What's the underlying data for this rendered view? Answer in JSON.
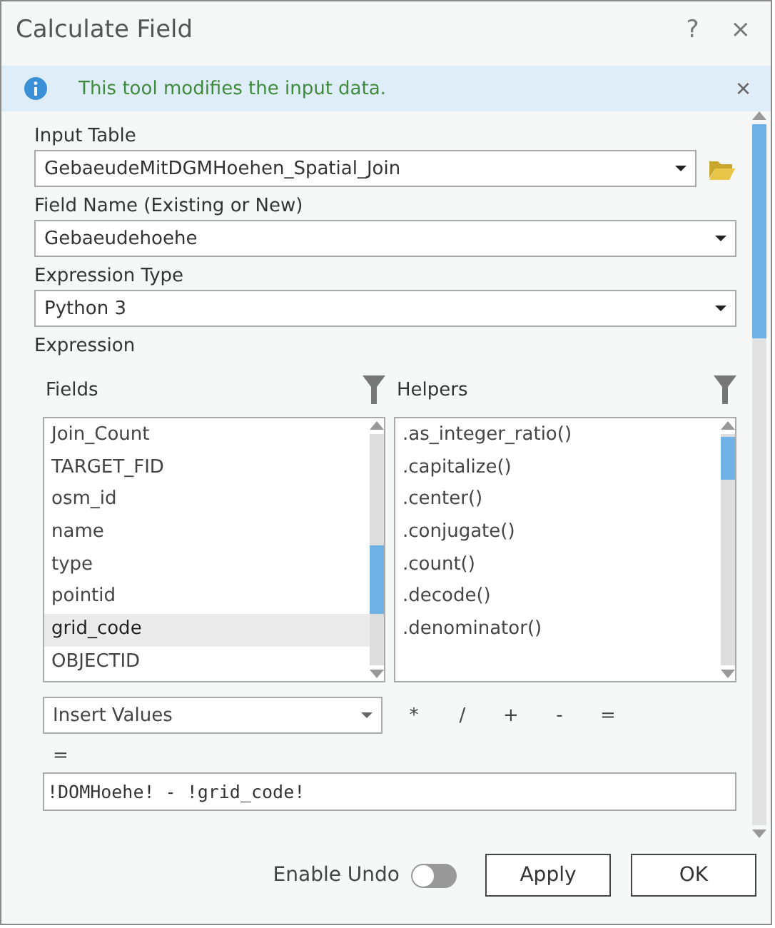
{
  "window": {
    "title": "Calculate Field",
    "help": "?",
    "close": "×"
  },
  "banner": {
    "message": "This tool modifies the input data.",
    "close": "×"
  },
  "input_table": {
    "label": "Input Table",
    "value": "GebaeudeMitDGMHoehen_Spatial_Join"
  },
  "field_name": {
    "label": "Field Name (Existing or New)",
    "value": "Gebaeudehoehe"
  },
  "expression_type": {
    "label": "Expression Type",
    "value": "Python 3"
  },
  "expression": {
    "label": "Expression",
    "fields": {
      "title": "Fields",
      "items": [
        {
          "label": "Join_Count",
          "selected": false
        },
        {
          "label": "TARGET_FID",
          "selected": false
        },
        {
          "label": "osm_id",
          "selected": false
        },
        {
          "label": "name",
          "selected": false
        },
        {
          "label": "type",
          "selected": false
        },
        {
          "label": "pointid",
          "selected": false
        },
        {
          "label": "grid_code",
          "selected": true
        },
        {
          "label": "OBJECTID",
          "selected": false
        }
      ]
    },
    "helpers": {
      "title": "Helpers",
      "items": [
        ".as_integer_ratio()",
        ".capitalize()",
        ".center()",
        ".conjugate()",
        ".count()",
        ".decode()",
        ".denominator()"
      ]
    },
    "insert_values": "Insert Values",
    "operators": [
      "*",
      "/",
      "+",
      "-",
      "="
    ],
    "equals": "=",
    "code": "!DOMHoehe! - !grid_code!"
  },
  "footer": {
    "enable_undo": {
      "label": "Enable Undo",
      "on": false
    },
    "buttons": [
      "Apply",
      "OK"
    ]
  }
}
